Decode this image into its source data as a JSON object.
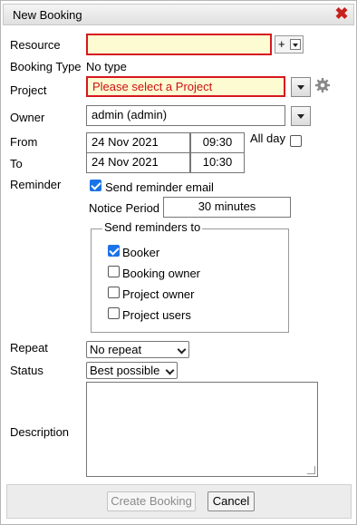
{
  "dialog": {
    "title": "New Booking",
    "close_icon": "close-x-icon"
  },
  "resource": {
    "label": "Resource",
    "value": "",
    "add_label": "+"
  },
  "booking_type": {
    "label": "Booking Type",
    "value": "No type"
  },
  "project": {
    "label": "Project",
    "value": "Please select a Project",
    "settings_icon": "gear-icon"
  },
  "owner": {
    "label": "Owner",
    "value": "admin (admin)"
  },
  "from": {
    "label": "From",
    "date": "24 Nov 2021",
    "time": "09:30",
    "allday_label": "All day",
    "allday_checked": false
  },
  "to": {
    "label": "To",
    "date": "24 Nov 2021",
    "time": "10:30"
  },
  "reminder": {
    "label": "Reminder",
    "send_email_label": "Send reminder email",
    "send_email_checked": true,
    "notice_label": "Notice Period",
    "notice_value": "30 minutes",
    "recipients_legend": "Send reminders to",
    "recipients": [
      {
        "label": "Booker",
        "checked": true
      },
      {
        "label": "Booking owner",
        "checked": false
      },
      {
        "label": "Project owner",
        "checked": false
      },
      {
        "label": "Project users",
        "checked": false
      }
    ]
  },
  "repeat": {
    "label": "Repeat",
    "value": "No repeat"
  },
  "status": {
    "label": "Status",
    "value": "Best possible"
  },
  "description": {
    "label": "Description",
    "value": ""
  },
  "footer": {
    "create_label": "Create Booking",
    "create_disabled": true,
    "cancel_label": "Cancel"
  },
  "colors": {
    "required_border": "#d6171f",
    "required_bg": "#fdfbd2",
    "checkbox_accent": "#1a73e8",
    "close_red": "#c8201c"
  }
}
